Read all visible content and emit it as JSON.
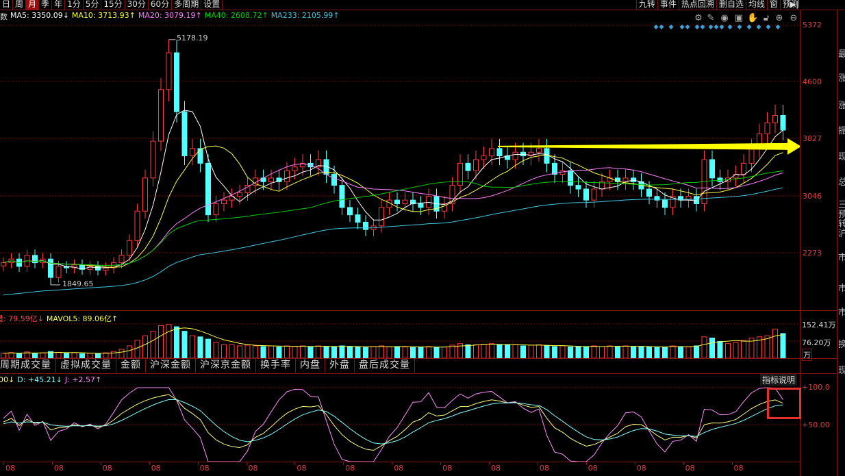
{
  "toolbar_left": [
    "日",
    "周",
    "月",
    "季",
    "年",
    "1分",
    "5分",
    "15分",
    "30分",
    "60分",
    "多周期",
    "设置"
  ],
  "active_period": "月",
  "toolbar_right": [
    "九转",
    "事件",
    "热点回溯",
    "删自选",
    "均线",
    "窗",
    "预测"
  ],
  "exit_icon": "collapse-right-icon",
  "ma_legend": {
    "prefix": "数",
    "ma5": "MA5: 3350.09↓",
    "ma10": "MA10: 3713.93↑",
    "ma20": "MA20: 3079.19↑",
    "ma40": "MA40: 2608.72↑",
    "ma233": "MA233: 2105.99↑"
  },
  "tool_icons": [
    "gear-icon",
    "pen-icon",
    "eye-icon",
    "toolbox-icon",
    "hand-icon",
    "lock-icon",
    "zoom-in-icon",
    "zoom-out-icon"
  ],
  "price_axis": [
    "5372",
    "4600",
    "3827",
    "3046",
    "2273"
  ],
  "high_label": "5178.19",
  "low_label": "1849.65",
  "volume_legend": {
    "vol": "量: 79.59亿↓",
    "mavol5": "MAVOL5: 89.06亿↑"
  },
  "volume_axis": [
    "152.41万",
    "76.20万",
    "万"
  ],
  "tabs": [
    "周期成交量",
    "虚拟成交量",
    "金额",
    "沪深金额",
    "沪深京金额",
    "换手率",
    "内盘",
    "外盘",
    "盘后成交量"
  ],
  "kdj_legend": {
    "k": "00↓",
    "d": "D: +45.21↓",
    "j": "J: +2.57↑"
  },
  "kdj_axis": [
    "+100.0",
    "+50.00"
  ],
  "indicator_help": "指标说明",
  "dates": [
    "08",
    "08",
    "08",
    "08",
    "08",
    "08",
    "08",
    "08",
    "08",
    "08",
    "08",
    "08",
    "08",
    "08",
    "08",
    "08"
  ],
  "side_panel": [
    "最",
    "涨",
    "涨",
    "振",
    "现",
    "总",
    "三",
    "预",
    "转",
    "沪",
    "市",
    "市",
    "市",
    "换",
    "现"
  ],
  "colors": {
    "up": "#ff3b3b",
    "down": "#54ffff",
    "ma5": "#ffffff",
    "ma10": "#ffff40",
    "ma20": "#ff80ff",
    "ma40": "#00d000",
    "ma233": "#40c8e0",
    "arrow": "#ffff00",
    "grid": "#8a1515"
  },
  "chart_data": {
    "type": "candlestick",
    "period": "monthly",
    "y_range": [
      1650,
      5372
    ],
    "closes": [
      2150,
      2200,
      2100,
      2250,
      2150,
      2200,
      1950,
      2100,
      2080,
      2120,
      2060,
      2100,
      2050,
      2080,
      2150,
      2250,
      2450,
      2850,
      3300,
      3800,
      4500,
      5000,
      4200,
      3600,
      3700,
      3500,
      2800,
      2950,
      3000,
      3050,
      3100,
      3200,
      3300,
      3250,
      3300,
      3250,
      3400,
      3450,
      3500,
      3450,
      3550,
      3350,
      3200,
      2900,
      2800,
      2700,
      2600,
      2650,
      2900,
      3000,
      2950,
      3000,
      2950,
      2900,
      3050,
      2850,
      2950,
      3200,
      3500,
      3400,
      3550,
      3600,
      3700,
      3600,
      3550,
      3650,
      3600,
      3650,
      3700,
      3500,
      3350,
      3400,
      3200,
      3150,
      3000,
      3150,
      3250,
      3300,
      3250,
      3300,
      3250,
      3150,
      3050,
      3000,
      2900,
      3050,
      3000,
      3050,
      2950,
      3550,
      3300,
      3250,
      3300,
      3350,
      3500,
      3700,
      3900,
      4050,
      4150,
      3950
    ],
    "volume_wan": [
      22,
      25,
      20,
      28,
      22,
      24,
      30,
      26,
      22,
      24,
      20,
      22,
      20,
      24,
      30,
      40,
      55,
      80,
      100,
      120,
      145,
      150,
      140,
      120,
      100,
      95,
      85,
      70,
      60,
      60,
      55,
      58,
      55,
      52,
      55,
      50,
      55,
      52,
      55,
      50,
      55,
      52,
      50,
      55,
      52,
      50,
      48,
      52,
      55,
      50,
      52,
      50,
      48,
      50,
      52,
      48,
      50,
      58,
      65,
      60,
      60,
      62,
      65,
      60,
      58,
      60,
      55,
      58,
      60,
      55,
      52,
      55,
      50,
      52,
      50,
      55,
      52,
      55,
      52,
      55,
      50,
      52,
      50,
      48,
      50,
      55,
      52,
      50,
      55,
      95,
      90,
      75,
      65,
      70,
      80,
      90,
      95,
      100,
      130,
      110
    ],
    "highlight_arrow": {
      "from_price": 3700,
      "direction": "right"
    },
    "kdj_range": [
      0,
      100
    ]
  }
}
